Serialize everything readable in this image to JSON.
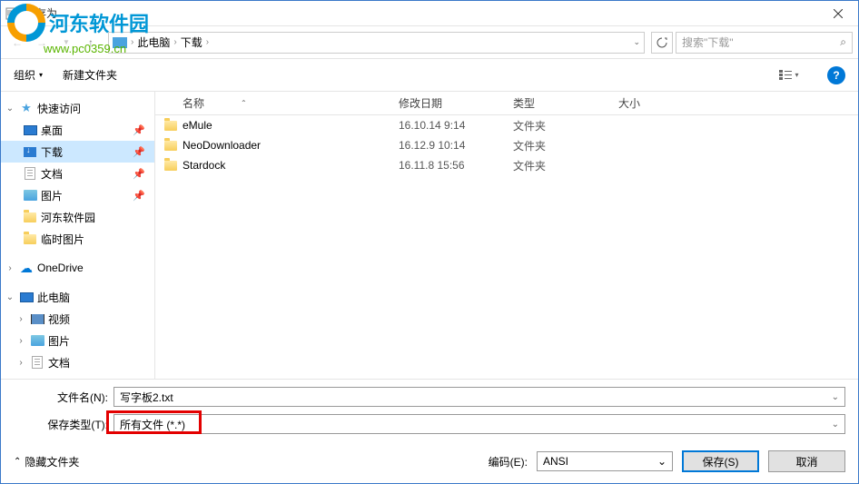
{
  "window": {
    "title": "另存为"
  },
  "watermark": {
    "name": "河东软件园",
    "url": "www.pc0359.cn"
  },
  "nav": {
    "path_root": "此电脑",
    "path_current": "下载",
    "search_placeholder": "搜索\"下载\""
  },
  "toolbar": {
    "organize": "组织",
    "organize_arrow": "▾",
    "newfolder": "新建文件夹"
  },
  "tree": {
    "quick_access": "快速访问",
    "desktop": "桌面",
    "downloads": "下载",
    "documents": "文档",
    "pictures": "图片",
    "hedong": "河东软件园",
    "temp_pic": "临时图片",
    "onedrive": "OneDrive",
    "this_pc": "此电脑",
    "video": "视频",
    "pictures2": "图片",
    "documents2": "文档"
  },
  "columns": {
    "name": "名称",
    "date": "修改日期",
    "type": "类型",
    "size": "大小"
  },
  "files": [
    {
      "name": "eMule",
      "date": "16.10.14 9:14",
      "type": "文件夹"
    },
    {
      "name": "NeoDownloader",
      "date": "16.12.9 10:14",
      "type": "文件夹"
    },
    {
      "name": "Stardock",
      "date": "16.11.8 15:56",
      "type": "文件夹"
    }
  ],
  "form": {
    "filename_label": "文件名(N):",
    "filename_value": "写字板2.txt",
    "filetype_label": "保存类型(T):",
    "filetype_value": "所有文件 (*.*)",
    "hide_folders": "隐藏文件夹",
    "encoding_label": "编码(E):",
    "encoding_value": "ANSI",
    "save": "保存(S)",
    "cancel": "取消"
  }
}
